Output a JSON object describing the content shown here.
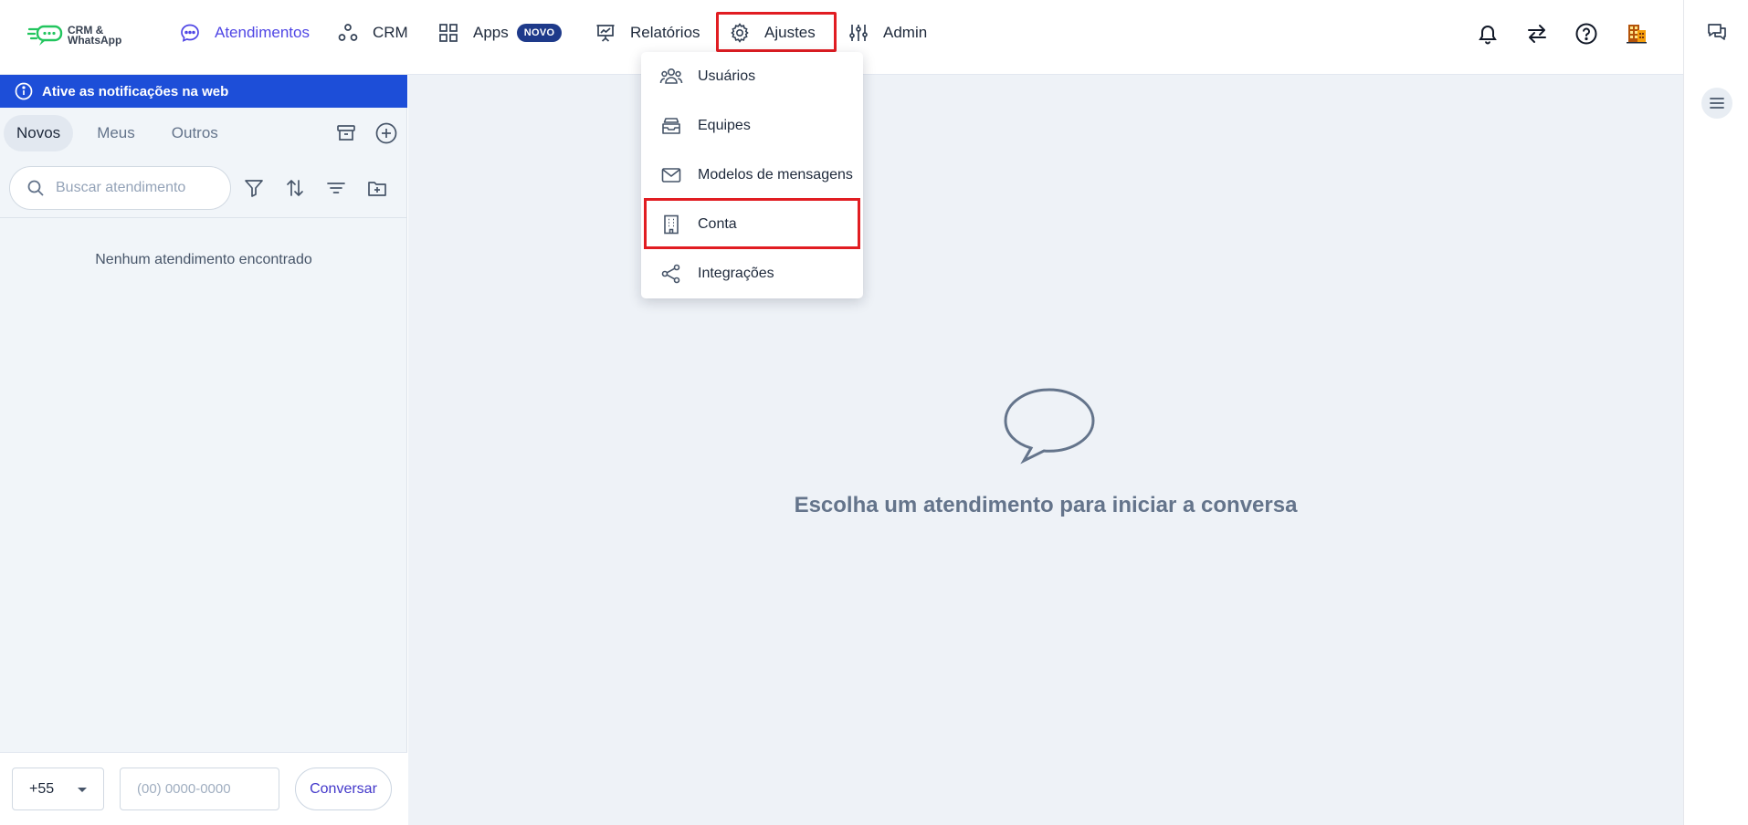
{
  "logo": {
    "line1": "CRM &",
    "line2": "WhatsApp"
  },
  "nav": {
    "atendimentos": "Atendimentos",
    "crm": "CRM",
    "apps": "Apps",
    "apps_badge": "NOVO",
    "relatorios": "Relatórios",
    "ajustes": "Ajustes",
    "admin": "Admin"
  },
  "ajustes_menu": {
    "items": [
      {
        "label": "Usuários",
        "icon": "users-icon"
      },
      {
        "label": "Equipes",
        "icon": "inbox-stack-icon"
      },
      {
        "label": "Modelos de mensagens",
        "icon": "envelope-icon"
      },
      {
        "label": "Conta",
        "icon": "building-icon"
      },
      {
        "label": "Integrações",
        "icon": "share-icon"
      }
    ]
  },
  "notification_bar": {
    "text": "Ative as notificações na web"
  },
  "tabs": [
    "Novos",
    "Meus",
    "Outros"
  ],
  "search": {
    "placeholder": "Buscar atendimento"
  },
  "empty_list": "Nenhum atendimento encontrado",
  "bottom": {
    "ddi": "+55",
    "phone_placeholder": "(00) 0000-0000",
    "button": "Conversar"
  },
  "main": {
    "empty_message": "Escolha um atendimento para iniciar a conversa"
  },
  "colors": {
    "primary": "#4f46e5",
    "notif_blue": "#1d4ed8",
    "badge": "#1e3a8a",
    "highlight": "#e11d22"
  }
}
